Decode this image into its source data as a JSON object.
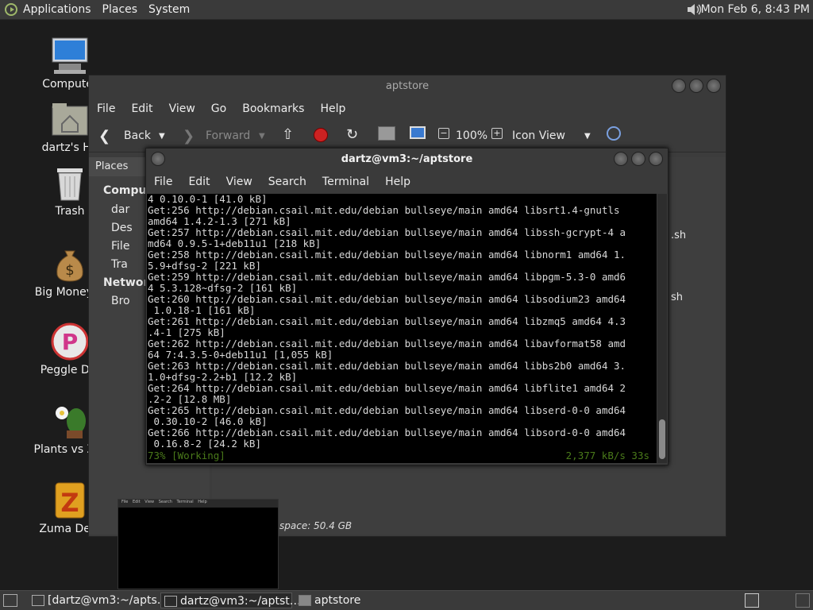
{
  "top_panel": {
    "menus": [
      "Applications",
      "Places",
      "System"
    ],
    "clock": "Mon Feb  6,  8:43 PM"
  },
  "desktop_icons": [
    {
      "label": "Computer",
      "icon": "computer-icon"
    },
    {
      "label": "dartz's Ho",
      "icon": "home-folder-icon"
    },
    {
      "label": "Trash",
      "icon": "trash-icon"
    },
    {
      "label": "Big Money D",
      "icon": "money-bag-icon"
    },
    {
      "label": "Peggle Del",
      "icon": "peggle-icon"
    },
    {
      "label": "Plants vs Zor",
      "icon": "plants-icon"
    },
    {
      "label": "Zuma Delu",
      "icon": "zuma-icon"
    }
  ],
  "file_manager": {
    "title": "aptstore",
    "menu": [
      "File",
      "Edit",
      "View",
      "Go",
      "Bookmarks",
      "Help"
    ],
    "toolbar": {
      "back": "Back",
      "forward": "Forward",
      "zoom": "100%",
      "view_mode": "Icon View"
    },
    "sidebar": {
      "header": "Places",
      "section_computer": "Comput",
      "items": [
        "dar",
        "Des",
        "File",
        "Tra"
      ],
      "section_network": "Network",
      "network_items": [
        "Bro"
      ]
    },
    "files_visible": [
      ".sh",
      "sh"
    ],
    "status": "space: 50.4 GB"
  },
  "terminal": {
    "title": "dartz@vm3:~/aptstore",
    "menu": [
      "File",
      "Edit",
      "View",
      "Search",
      "Terminal",
      "Help"
    ],
    "lines": [
      "4 0.10.0-1 [41.0 kB]",
      "Get:256 http://debian.csail.mit.edu/debian bullseye/main amd64 libsrt1.4-gnutls",
      "amd64 1.4.2-1.3 [271 kB]",
      "Get:257 http://debian.csail.mit.edu/debian bullseye/main amd64 libssh-gcrypt-4 a",
      "md64 0.9.5-1+deb11u1 [218 kB]",
      "Get:258 http://debian.csail.mit.edu/debian bullseye/main amd64 libnorm1 amd64 1.",
      "5.9+dfsg-2 [221 kB]",
      "Get:259 http://debian.csail.mit.edu/debian bullseye/main amd64 libpgm-5.3-0 amd6",
      "4 5.3.128~dfsg-2 [161 kB]",
      "Get:260 http://debian.csail.mit.edu/debian bullseye/main amd64 libsodium23 amd64",
      " 1.0.18-1 [161 kB]",
      "Get:261 http://debian.csail.mit.edu/debian bullseye/main amd64 libzmq5 amd64 4.3",
      ".4-1 [275 kB]",
      "Get:262 http://debian.csail.mit.edu/debian bullseye/main amd64 libavformat58 amd",
      "64 7:4.3.5-0+deb11u1 [1,055 kB]",
      "Get:263 http://debian.csail.mit.edu/debian bullseye/main amd64 libbs2b0 amd64 3.",
      "1.0+dfsg-2.2+b1 [12.2 kB]",
      "Get:264 http://debian.csail.mit.edu/debian bullseye/main amd64 libflite1 amd64 2",
      ".2-2 [12.8 MB]",
      "Get:265 http://debian.csail.mit.edu/debian bullseye/main amd64 libserd-0-0 amd64",
      " 0.30.10-2 [46.0 kB]",
      "Get:266 http://debian.csail.mit.edu/debian bullseye/main amd64 libsord-0-0 amd64",
      " 0.16.8-2 [24.2 kB]"
    ],
    "progress_left": "73% [Working]",
    "progress_right": "2,377 kB/s 33s"
  },
  "thumbnail_preview": {
    "menu": [
      "File",
      "Edit",
      "View",
      "Search",
      "Terminal",
      "Help"
    ]
  },
  "taskbar": {
    "items": [
      {
        "label": "[dartz@vm3:~/apts…",
        "icon": "terminal-icon"
      },
      {
        "label": "dartz@vm3:~/aptst…",
        "icon": "terminal-icon"
      },
      {
        "label": "aptstore",
        "icon": "folder-icon"
      }
    ]
  }
}
